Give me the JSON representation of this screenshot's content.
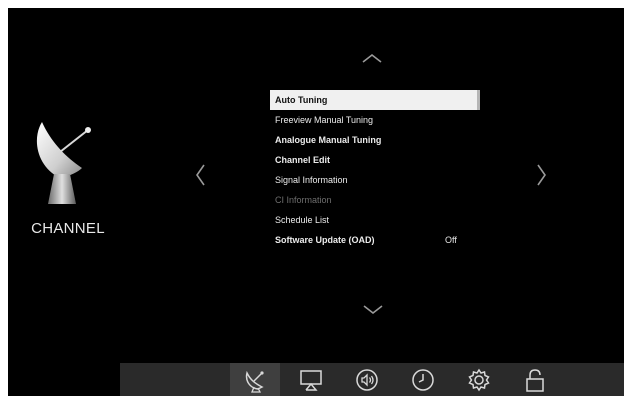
{
  "section": {
    "label": "CHANNEL",
    "icon": "satellite-dish-icon"
  },
  "menu": {
    "items": [
      {
        "label": "Auto Tuning",
        "state": "selected"
      },
      {
        "label": "Freeview Manual Tuning",
        "state": "normal"
      },
      {
        "label": "Analogue Manual Tuning",
        "state": "normal"
      },
      {
        "label": "Channel Edit",
        "state": "normal"
      },
      {
        "label": "Signal Information",
        "state": "normal"
      },
      {
        "label": "CI Information",
        "state": "disabled"
      },
      {
        "label": "Schedule List",
        "state": "normal"
      },
      {
        "label": "Software Update (OAD)",
        "state": "normal",
        "value": "Off"
      }
    ]
  },
  "nav": {
    "up_icon": "chevron-up-icon",
    "down_icon": "chevron-down-icon",
    "left_icon": "chevron-left-icon",
    "right_icon": "chevron-right-icon"
  },
  "bottom_bar": {
    "icons": [
      "satellite-dish-icon",
      "picture-screen-icon",
      "speaker-icon",
      "clock-icon",
      "gear-icon",
      "lock-icon"
    ],
    "active": 0
  },
  "colors": {
    "background": "#000000",
    "text": "#ececec",
    "selected_bg": "#f0f0f0",
    "selected_text": "#111111",
    "disabled_text": "#6e6e6e",
    "bar_bg": "#2a2a2a"
  }
}
